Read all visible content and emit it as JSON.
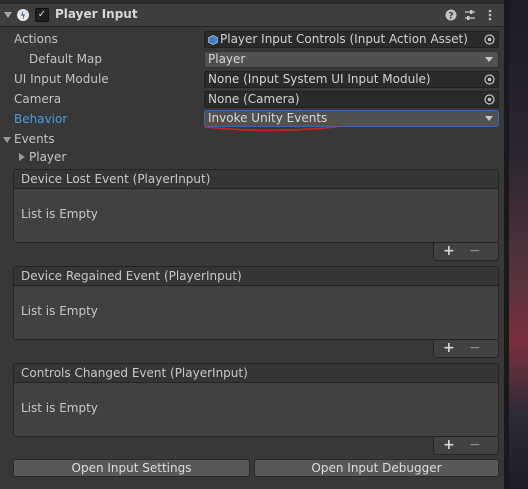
{
  "component": {
    "title": "Player Input",
    "enabled_check": "✓",
    "icons": [
      "input-system-icon",
      "help-icon",
      "preset-icon",
      "more-options-icon"
    ]
  },
  "fields": {
    "actions": {
      "label": "Actions",
      "value": "Player Input Controls (Input Action Asset)"
    },
    "default_map": {
      "label": "Default Map",
      "value": "Player"
    },
    "ui_input_module": {
      "label": "UI Input Module",
      "value": "None (Input System UI Input Module)"
    },
    "camera": {
      "label": "Camera",
      "value": "None (Camera)"
    },
    "behavior": {
      "label": "Behavior",
      "value": "Invoke Unity Events"
    }
  },
  "events": {
    "label": "Events",
    "player_foldout": "Player",
    "lists": [
      {
        "title": "Device Lost Event (PlayerInput)",
        "empty_text": "List is Empty"
      },
      {
        "title": "Device Regained Event (PlayerInput)",
        "empty_text": "List is Empty"
      },
      {
        "title": "Controls Changed Event (PlayerInput)",
        "empty_text": "List is Empty"
      }
    ],
    "add_label": "+",
    "remove_label": "−"
  },
  "buttons": {
    "open_settings": "Open Input Settings",
    "open_debugger": "Open Input Debugger"
  },
  "colors": {
    "highlight_label": "#4c9ae6",
    "annotation_underline": "#d62020"
  }
}
